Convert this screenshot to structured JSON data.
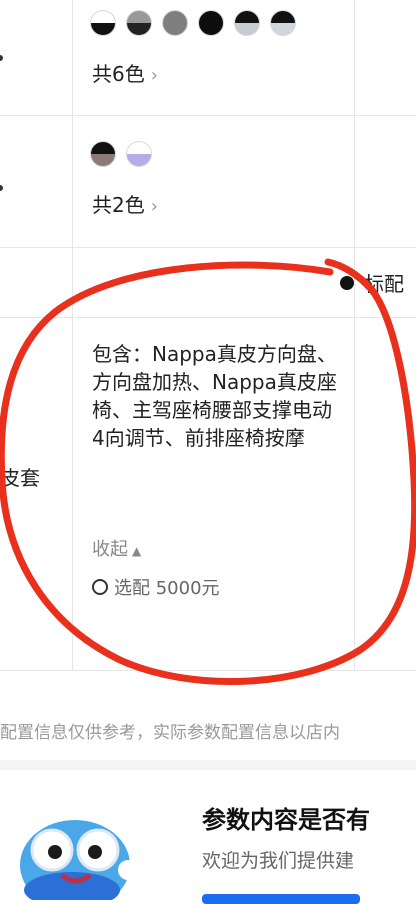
{
  "colors": {
    "option1": {
      "swatches": [
        {
          "name": "black-white",
          "top": "#ffffff",
          "bottom": "#111111"
        },
        {
          "name": "grey-black",
          "top": "#999999",
          "bottom": "#222222"
        },
        {
          "name": "mid-grey",
          "top": "#7f7f7f",
          "bottom": "#7f7f7f"
        },
        {
          "name": "black",
          "top": "#0d0d0d",
          "bottom": "#0d0d0d"
        },
        {
          "name": "black-grey",
          "top": "#111111",
          "bottom": "#c6ccd3"
        },
        {
          "name": "black-silver",
          "top": "#111111",
          "bottom": "#cfd6de"
        }
      ],
      "count_label": "共6色"
    },
    "option2": {
      "swatches": [
        {
          "name": "black-brown",
          "top": "#111111",
          "bottom": "#8b7a77"
        },
        {
          "name": "white-lavender",
          "top": "#ffffff",
          "bottom": "#b3aee5"
        }
      ],
      "count_label": "共2色"
    }
  },
  "standard_label": "标配",
  "left_label": "皮套",
  "package_detail": "包含：Nappa真皮方向盘、方向盘加热、Nappa真皮座椅、主驾座椅腰部支撑电动4向调节、前排座椅按摩",
  "collapse_label": "收起",
  "optional_label": "选配 5000元",
  "disclaimer": "配置信息仅供参考，实际参数配置信息以店内",
  "feedback": {
    "title": "参数内容是否有",
    "subtitle": "欢迎为我们提供建"
  },
  "annotation_color": "#e8301c"
}
